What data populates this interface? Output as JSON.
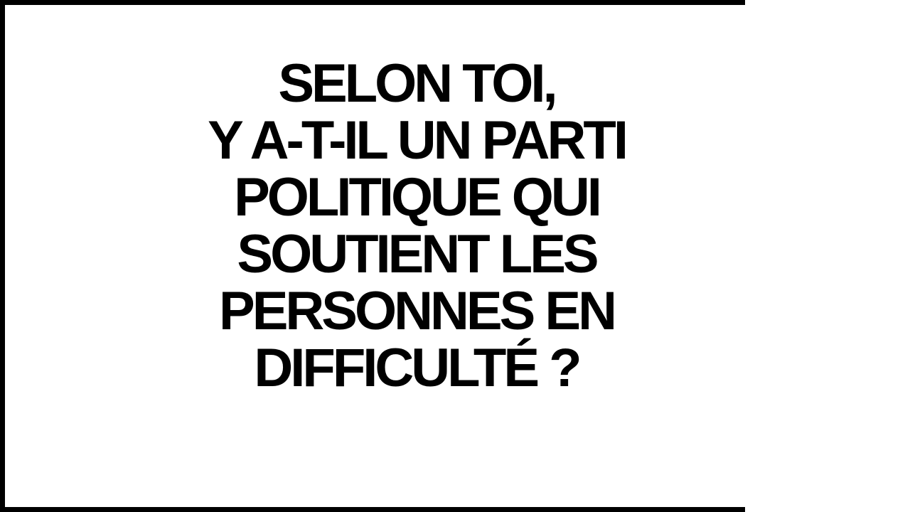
{
  "slide": {
    "lines": [
      "SELON TOI,",
      "Y A-T-IL UN PARTI",
      "POLITIQUE QUI",
      "SOUTIENT LES",
      "PERSONNES EN",
      "DIFFICULTÉ ?"
    ]
  }
}
